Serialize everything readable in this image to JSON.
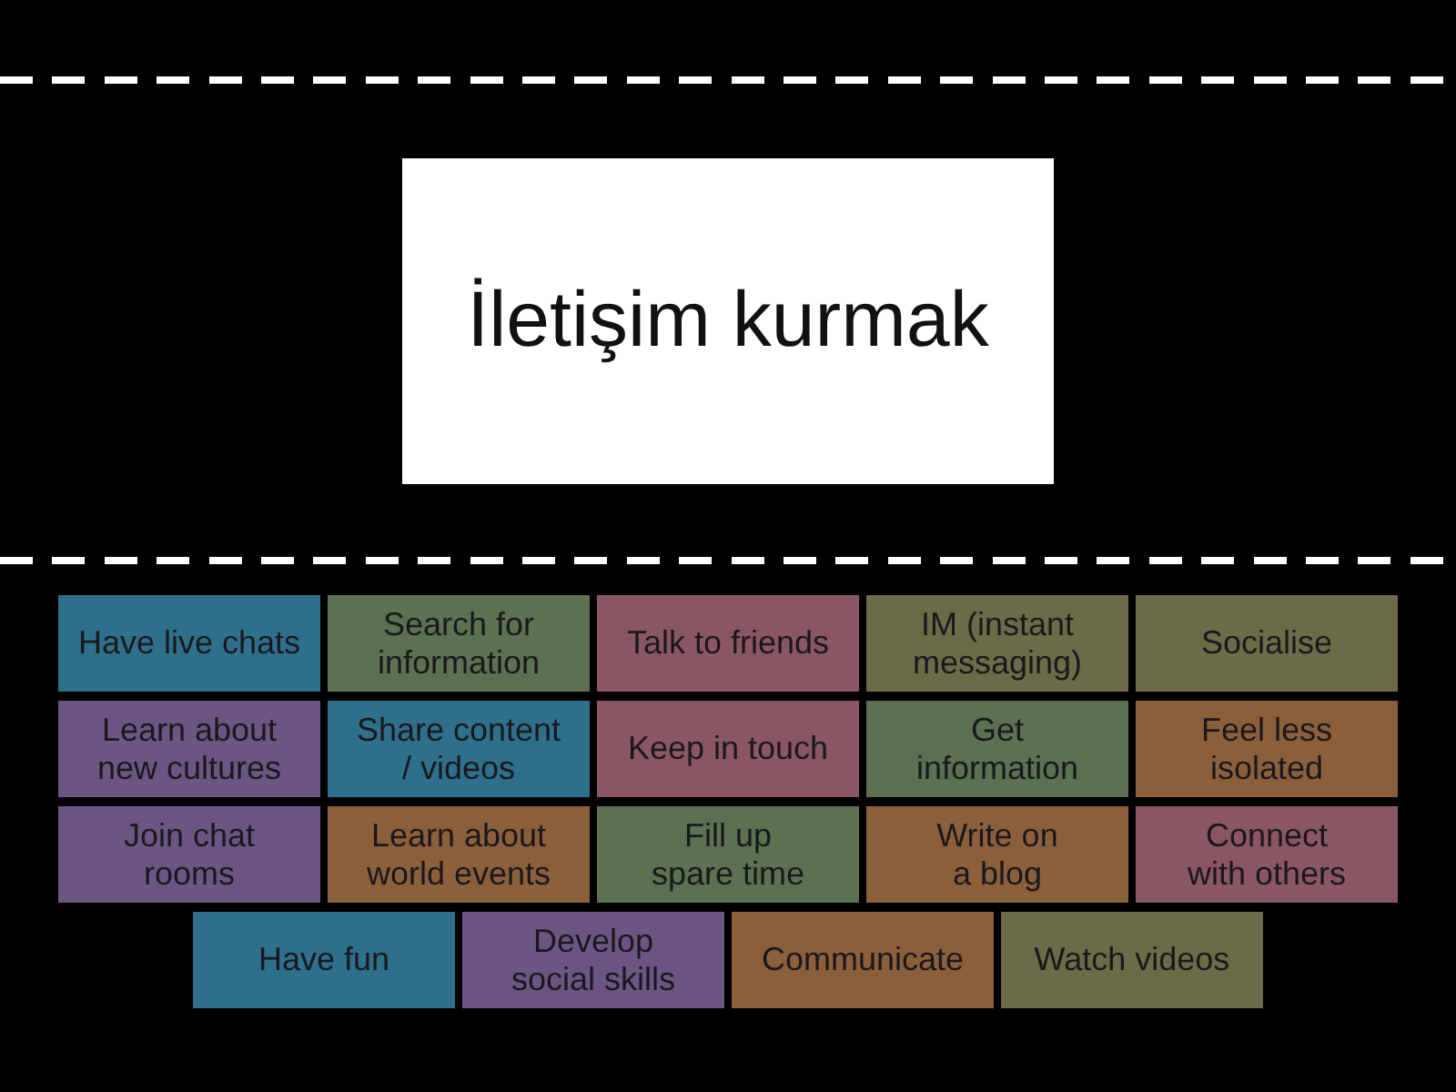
{
  "prompt": {
    "title": "İletişim kurmak"
  },
  "tiles": [
    {
      "lines": [
        "Have live chats"
      ],
      "color": "#2e6f8c"
    },
    {
      "lines": [
        "Search for",
        "information"
      ],
      "color": "#5b7152"
    },
    {
      "lines": [
        "Talk to friends"
      ],
      "color": "#8a5663"
    },
    {
      "lines": [
        "IM (instant",
        "messaging)"
      ],
      "color": "#6b6b47"
    },
    {
      "lines": [
        "Socialise"
      ],
      "color": "#6b6b47"
    },
    {
      "lines": [
        "Learn about",
        "new cultures"
      ],
      "color": "#6b5683"
    },
    {
      "lines": [
        "Share content",
        "/ videos"
      ],
      "color": "#2e6f8c"
    },
    {
      "lines": [
        "Keep in touch"
      ],
      "color": "#8a5663"
    },
    {
      "lines": [
        "Get",
        "information"
      ],
      "color": "#5b7152"
    },
    {
      "lines": [
        "Feel less",
        "isolated"
      ],
      "color": "#8c5f3b"
    },
    {
      "lines": [
        "Join chat",
        "rooms"
      ],
      "color": "#6b5683"
    },
    {
      "lines": [
        "Learn about",
        "world events"
      ],
      "color": "#8c5f3b"
    },
    {
      "lines": [
        "Fill up",
        "spare time"
      ],
      "color": "#5b7152"
    },
    {
      "lines": [
        "Write on",
        "a blog"
      ],
      "color": "#8c5f3b"
    },
    {
      "lines": [
        "Connect",
        "with others"
      ],
      "color": "#8a5663"
    },
    {
      "lines": [
        "Have fun"
      ],
      "color": "#2e6f8c"
    },
    {
      "lines": [
        "Develop",
        "social skills"
      ],
      "color": "#6b5683"
    },
    {
      "lines": [
        "Communicate"
      ],
      "color": "#8c5f3b"
    },
    {
      "lines": [
        "Watch videos"
      ],
      "color": "#6b6b47"
    }
  ]
}
